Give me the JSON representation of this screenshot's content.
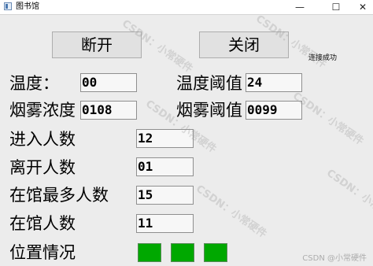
{
  "window": {
    "title": "图书馆",
    "minimize_glyph": "—",
    "maximize_glyph": "☐",
    "close_glyph": "✕",
    "icon": "app-window-icon"
  },
  "buttons": {
    "disconnect": "断开",
    "close": "关闭"
  },
  "status": "连接成功",
  "fields": {
    "temperature": {
      "label": "温度：",
      "value": "00"
    },
    "temperature_threshold": {
      "label": "温度阈值",
      "value": "24"
    },
    "smoke_concentration": {
      "label": "烟雾浓度",
      "value": "0108"
    },
    "smoke_threshold": {
      "label": "烟雾阈值",
      "value": "0099"
    },
    "entered_count": {
      "label": "进入人数",
      "value": "12"
    },
    "left_count": {
      "label": "离开人数",
      "value": "01"
    },
    "max_in_library": {
      "label": "在馆最多人数",
      "value": "15"
    },
    "in_library": {
      "label": "在馆人数",
      "value": "11"
    },
    "seat_status": {
      "label": "位置情况"
    }
  },
  "seats": [
    {
      "color": "#00a800"
    },
    {
      "color": "#00a800"
    },
    {
      "color": "#00a800"
    }
  ],
  "watermark": {
    "repeat_text": "CSDN：小常硬件",
    "bottom_text": "CSDN @小常硬件"
  }
}
